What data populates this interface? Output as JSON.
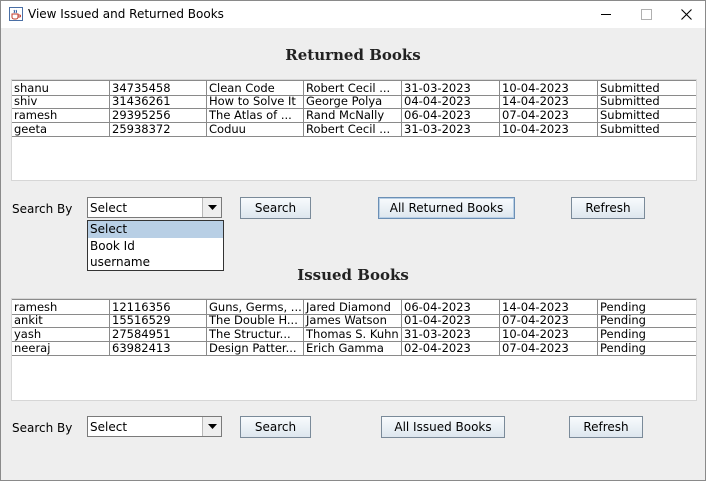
{
  "window": {
    "title": "View Issued and Returned Books",
    "controls": {
      "minimize": "—",
      "maximize": "☐",
      "close": "✕"
    }
  },
  "returned": {
    "heading": "Returned Books",
    "rows": [
      [
        "shanu",
        "34735458",
        "Clean Code",
        "Robert Cecil ...",
        "31-03-2023",
        "10-04-2023",
        "Submitted"
      ],
      [
        "shiv",
        "31436261",
        "How to Solve It",
        "George Polya",
        "04-04-2023",
        "14-04-2023",
        "Submitted"
      ],
      [
        "ramesh",
        "29395256",
        "The Atlas of ...",
        "Rand McNally",
        "06-04-2023",
        "07-04-2023",
        "Submitted"
      ],
      [
        "geeta",
        "25938372",
        "Coduu",
        "Robert Cecil ...",
        "31-03-2023",
        "10-04-2023",
        "Submitted"
      ]
    ],
    "search_label": "Search By",
    "combo_value": "Select",
    "search_button": "Search",
    "all_button": "All Returned Books",
    "refresh_button": "Refresh",
    "dropdown_options": [
      "Select",
      "Book Id",
      "username"
    ],
    "dropdown_selected": "Select"
  },
  "issued": {
    "heading": "Issued Books",
    "rows": [
      [
        "ramesh",
        "12116356",
        "Guns, Germs, ...",
        "Jared Diamond",
        "06-04-2023",
        "14-04-2023",
        "Pending"
      ],
      [
        "ankit",
        "15516529",
        "The Double H...",
        "James Watson",
        "01-04-2023",
        "07-04-2023",
        "Pending"
      ],
      [
        "yash",
        "27584951",
        "The Structur...",
        "Thomas S. Kuhn",
        "31-03-2023",
        "10-04-2023",
        "Pending"
      ],
      [
        "neeraj",
        "63982413",
        "Design Patter...",
        "Erich Gamma",
        "02-04-2023",
        "07-04-2023",
        "Pending"
      ]
    ],
    "search_label": "Search By",
    "combo_value": "Select",
    "search_button": "Search",
    "all_button": "All Issued Books",
    "refresh_button": "Refresh"
  },
  "icons": {
    "app": "java-coffee-cup-icon",
    "combo_arrow": "triangle-down-icon"
  },
  "colors": {
    "selection": "#b8cfe5",
    "grid_line": "#8a8a8a"
  }
}
